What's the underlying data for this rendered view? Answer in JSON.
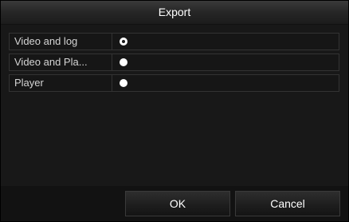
{
  "dialog": {
    "title": "Export"
  },
  "options": [
    {
      "label": "Video and log",
      "selected": true
    },
    {
      "label": "Video and Pla...",
      "selected": false
    },
    {
      "label": "Player",
      "selected": false
    }
  ],
  "buttons": {
    "ok_label": "OK",
    "cancel_label": "Cancel"
  }
}
